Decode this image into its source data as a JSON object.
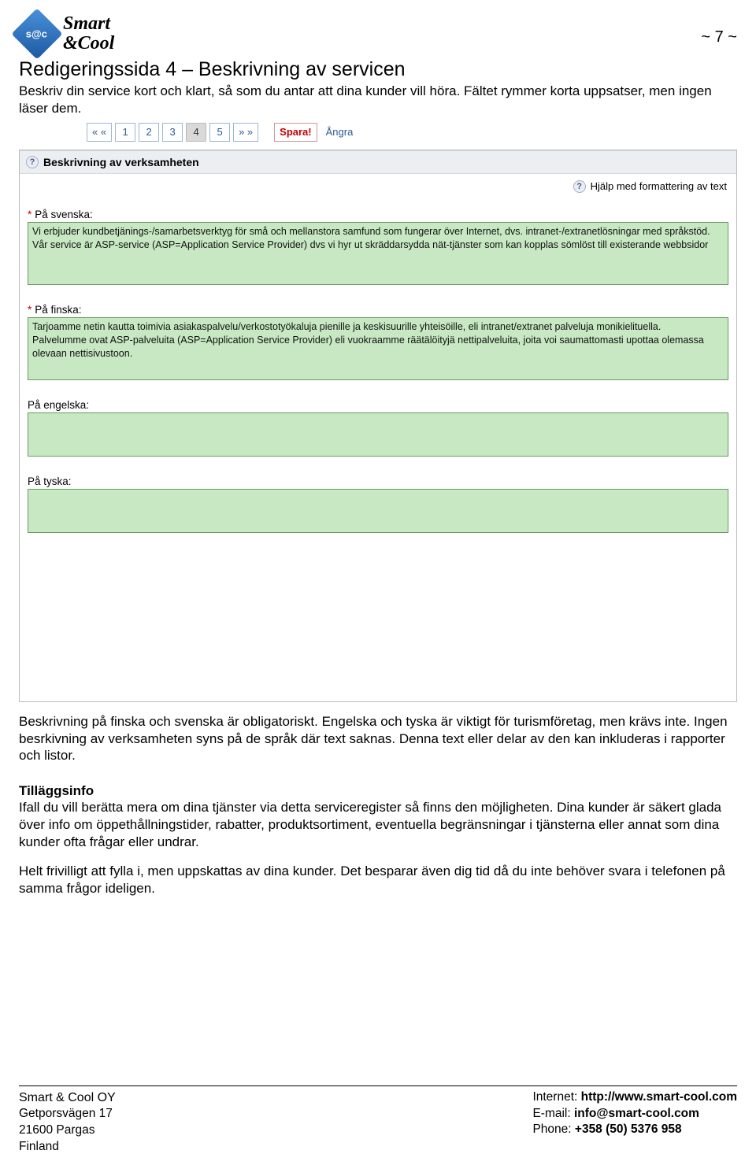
{
  "brand": {
    "logo_text": "s@c",
    "line1": "Smart",
    "line2": "&Cool"
  },
  "page_number": "~ 7 ~",
  "title": "Redigeringssida 4 – Beskrivning av servicen",
  "lead": "Beskriv din service kort och klart, så som du antar att dina kunder vill höra. Fältet rymmer korta uppsatser, men ingen läser dem.",
  "pager": {
    "first": "« «",
    "pages": [
      "1",
      "2",
      "3",
      "4",
      "5"
    ],
    "active_index": 3,
    "last": "» »",
    "save": "Spara!",
    "undo": "Ångra"
  },
  "panel": {
    "section_title": "Beskrivning av verksamheten",
    "help_link": "Hjälp med formattering av text",
    "fields": [
      {
        "label": "På svenska:",
        "required": true,
        "value": "Vi erbjuder kundbetjänings-/samarbetsverktyg för små och mellanstora samfund som fungerar över Internet, dvs. intranet-/extranetlösningar med språkstöd.\nVår service är ASP-service (ASP=Application Service Provider) dvs vi hyr ut skräddarsydda nät-tjänster som kan kopplas sömlöst till existerande webbsidor"
      },
      {
        "label": "På finska:",
        "required": true,
        "value": "Tarjoamme netin kautta toimivia asiakaspalvelu/verkostotyökaluja pienille ja keskisuurille yhteisöille, eli intranet/extranet palveluja monikielituella.\nPalvelumme ovat ASP-palveluita (ASP=Application Service Provider) eli vuokraamme räätälöityjä nettipalveluita, joita voi saumattomasti upottaa olemassa olevaan nettisivustoon."
      },
      {
        "label": "På engelska:",
        "required": false,
        "value": ""
      },
      {
        "label": "På tyska:",
        "required": false,
        "value": ""
      }
    ]
  },
  "copy": {
    "p1": "Beskrivning på finska och svenska är obligatoriskt. Engelska och tyska är viktigt för turismföretag, men krävs inte. Ingen besrkivning av verksamheten syns på de språk där text saknas. Denna text eller delar av den kan inkluderas i rapporter och listor.",
    "h3": "Tilläggsinfo",
    "p2": "Ifall du vill berätta mera om dina tjänster via detta serviceregister så finns den möjligheten. Dina kunder är säkert glada över info om öppethållningstider, rabatter, produktsortiment, eventuella begränsningar i tjänsterna eller annat som dina kunder ofta frågar eller undrar.",
    "p3": "Helt frivilligt att fylla i, men uppskattas av dina kunder. Det besparar även dig tid då du inte behöver svara i telefonen på samma frågor ideligen."
  },
  "footer": {
    "company": "Smart & Cool OY",
    "addr1": "Getporsvägen 17",
    "addr2": "21600 Pargas",
    "addr3": "Finland",
    "internet_label": "Internet: ",
    "internet": "http://www.smart-cool.com",
    "email_label": "E-mail: ",
    "email": "info@smart-cool.com",
    "phone_label": "Phone: ",
    "phone": "+358 (50) 5376 958"
  }
}
